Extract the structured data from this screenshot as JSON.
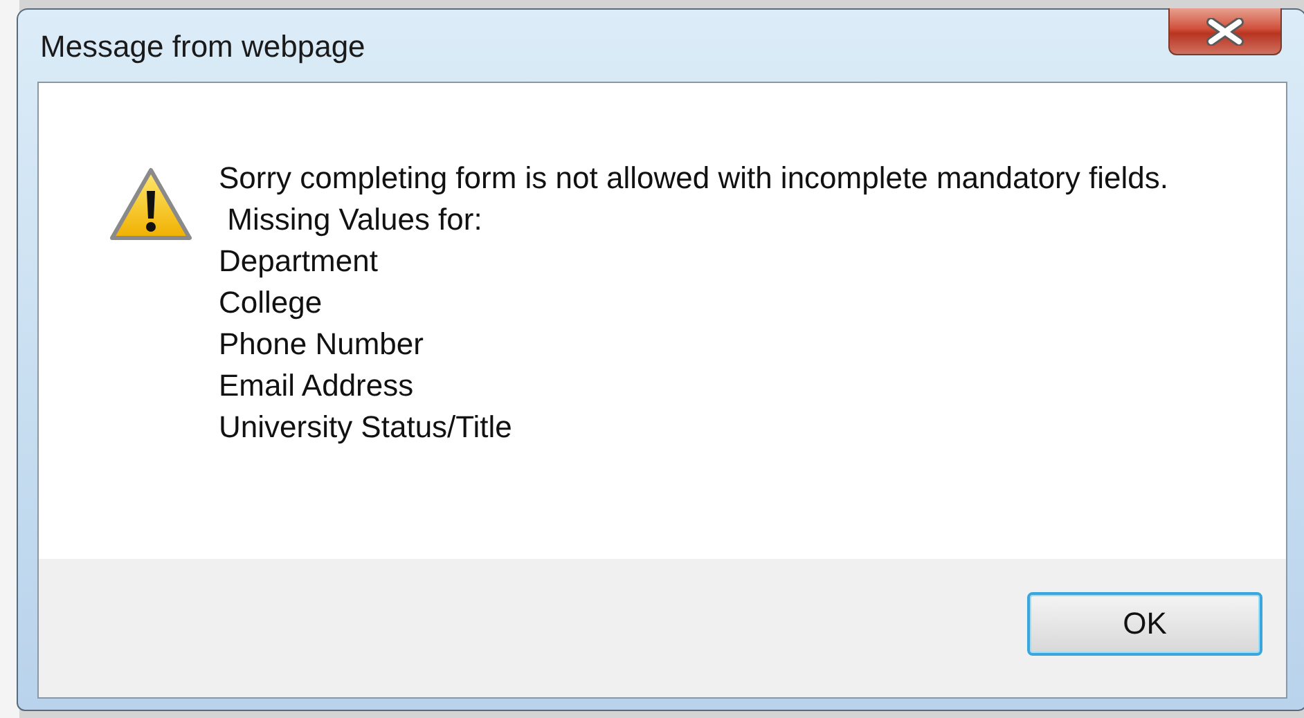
{
  "window": {
    "title": "Message from webpage"
  },
  "message": {
    "lines": [
      "Sorry completing form is not allowed with incomplete mandatory fields.",
      " Missing Values for:",
      "Department",
      "College",
      "Phone Number",
      "Email Address",
      "University Status/Title"
    ]
  },
  "buttons": [
    {
      "label": "OK",
      "selected": true
    }
  ]
}
